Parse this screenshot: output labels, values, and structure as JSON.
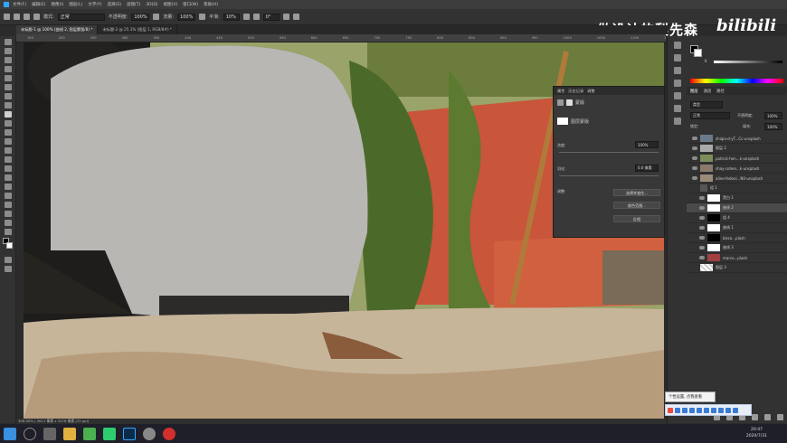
{
  "menu": [
    "文件(F)",
    "编辑(E)",
    "图像(I)",
    "图层(L)",
    "文字(Y)",
    "选择(S)",
    "滤镜(T)",
    "3D(D)",
    "视图(V)",
    "窗口(W)",
    "帮助(H)"
  ],
  "options": {
    "mode_label": "模式:",
    "mode_value": "正常",
    "opacity_label": "不透明度:",
    "opacity_value": "100%",
    "flow_label": "流量:",
    "flow_value": "100%",
    "smooth_label": "平滑:",
    "smooth_value": "10%",
    "angle_value": "0°"
  },
  "watermark": "做设计的梨先森",
  "watermark2": "bilibili",
  "tabs": [
    {
      "label": "未标题-1 @ 100% (曲线 2, 图层蒙版/8) *"
    },
    {
      "label": "未标题-2 @ 25.1% (图层 1, RGB/8#) *"
    }
  ],
  "ruler_ticks": [
    "150",
    "200",
    "250",
    "300",
    "350",
    "400",
    "450",
    "500",
    "550",
    "600",
    "650",
    "700",
    "750",
    "800",
    "850",
    "900",
    "950",
    "1000",
    "1050",
    "1100",
    "1150",
    "1200",
    "1250",
    "1300",
    "1350"
  ],
  "status": "306.00% | 3011 像素 x 3176 像素 (72 ppi)",
  "properties": {
    "tabs": [
      "属性",
      "历史记录",
      "调整"
    ],
    "section": "蒙版",
    "mask_label": "图层蒙版",
    "density_label": "浓度:",
    "density_value": "100%",
    "feather_label": "羽化:",
    "feather_value": "0.0 像素",
    "refine_label": "调整:",
    "btn_select_mask": "选择并遮住...",
    "btn_color_range": "颜色范围...",
    "btn_invert": "反相"
  },
  "right_panel": {
    "tabs": [
      "图层",
      "通道",
      "路径"
    ],
    "kind_label": "类型",
    "blend": "正常",
    "opacity_label": "不透明度:",
    "opacity": "100%",
    "lock_label": "锁定:",
    "fill_label": "填充:",
    "fill": "100%",
    "color_channel": "K"
  },
  "layers": [
    {
      "name": "zhiqia-d-yT...Cc-unsplash"
    },
    {
      "name": "图层 2"
    },
    {
      "name": "patrick-hen...k-unsplash"
    },
    {
      "name": "shay-cohen...k-unsplash"
    },
    {
      "name": "aline-fedoni...N0-unsplash"
    },
    {
      "name": "组 1"
    },
    {
      "name": "黑白 1"
    },
    {
      "name": "曲线 2"
    },
    {
      "name": "组 4"
    },
    {
      "name": "曲线 1"
    },
    {
      "name": "bisco...plash"
    },
    {
      "name": "曲线 3"
    },
    {
      "name": "marco...plash"
    },
    {
      "name": "图层 3"
    }
  ],
  "tooltip": "个性设置, 点我查看",
  "clock": {
    "time": "20:47",
    "date": "2020/7/31"
  }
}
